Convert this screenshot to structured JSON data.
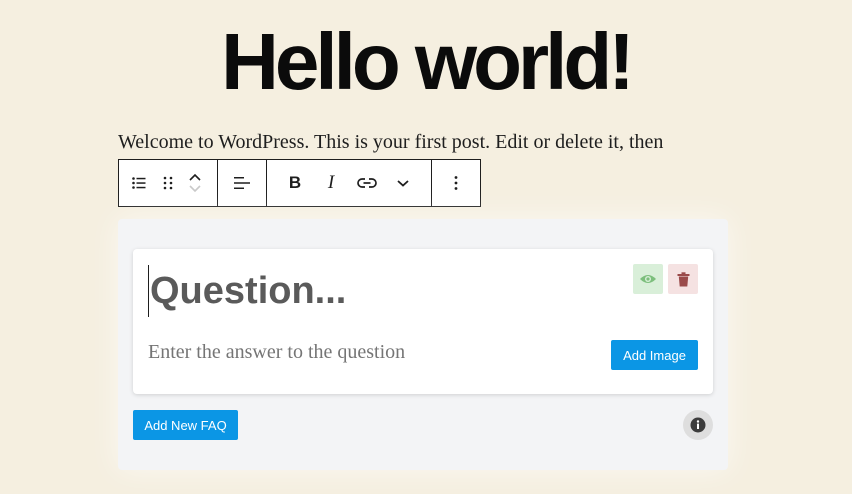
{
  "post": {
    "title": "Hello world!",
    "paragraph": "Welcome to WordPress. This is your first post. Edit or delete it, then"
  },
  "toolbar": {
    "icons": [
      "list-icon",
      "drag-handle-icon",
      "move-up-icon",
      "move-down-icon",
      "align-left-icon",
      "bold-icon",
      "italic-icon",
      "link-icon",
      "chevron-down-icon",
      "more-options-icon"
    ],
    "bold_glyph": "B",
    "italic_glyph": "I"
  },
  "faq": {
    "question_placeholder": "Question...",
    "answer_placeholder": "Enter the answer to the question",
    "add_image_label": "Add Image",
    "add_faq_label": "Add New FAQ"
  },
  "colors": {
    "background": "#f5efe0",
    "accent": "#0b96e5",
    "eye_bg": "#d9efd9",
    "trash_bg": "#f5e2e2"
  }
}
